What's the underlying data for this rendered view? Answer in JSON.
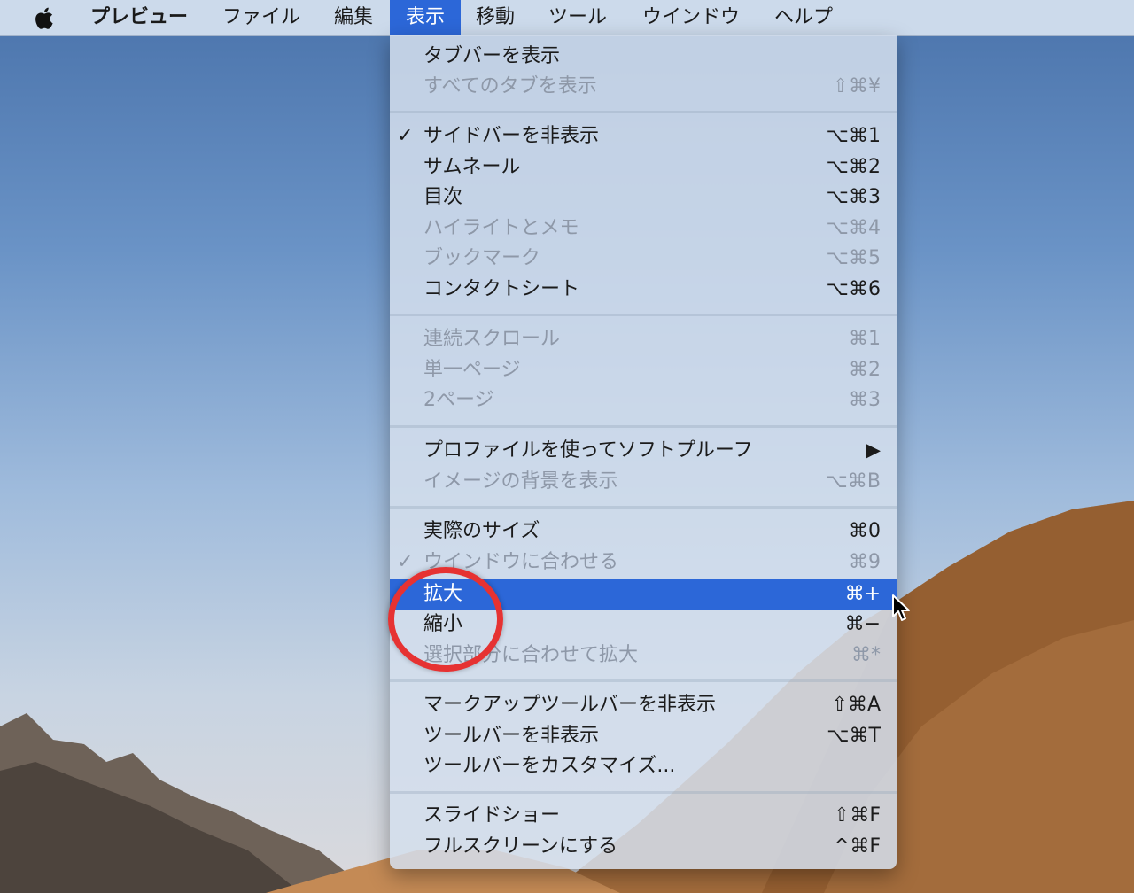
{
  "menubar": {
    "items": [
      {
        "label": "プレビュー",
        "bold": true,
        "active": false
      },
      {
        "label": "ファイル",
        "bold": false,
        "active": false
      },
      {
        "label": "編集",
        "bold": false,
        "active": false
      },
      {
        "label": "表示",
        "bold": false,
        "active": true
      },
      {
        "label": "移動",
        "bold": false,
        "active": false
      },
      {
        "label": "ツール",
        "bold": false,
        "active": false
      },
      {
        "label": "ウインドウ",
        "bold": false,
        "active": false
      },
      {
        "label": "ヘルプ",
        "bold": false,
        "active": false
      }
    ]
  },
  "view_menu": {
    "groups": [
      [
        {
          "label": "タブバーを表示",
          "shortcut": "",
          "enabled": true
        },
        {
          "label": "すべてのタブを表示",
          "shortcut": "⇧⌘¥",
          "enabled": false
        }
      ],
      [
        {
          "label": "サイドバーを非表示",
          "shortcut": "⌥⌘1",
          "enabled": true,
          "checked": true
        },
        {
          "label": "サムネール",
          "shortcut": "⌥⌘2",
          "enabled": true
        },
        {
          "label": "目次",
          "shortcut": "⌥⌘3",
          "enabled": true
        },
        {
          "label": "ハイライトとメモ",
          "shortcut": "⌥⌘4",
          "enabled": false
        },
        {
          "label": "ブックマーク",
          "shortcut": "⌥⌘5",
          "enabled": false
        },
        {
          "label": "コンタクトシート",
          "shortcut": "⌥⌘6",
          "enabled": true
        }
      ],
      [
        {
          "label": "連続スクロール",
          "shortcut": "⌘1",
          "enabled": false
        },
        {
          "label": "単一ページ",
          "shortcut": "⌘2",
          "enabled": false
        },
        {
          "label": "2ページ",
          "shortcut": "⌘3",
          "enabled": false
        }
      ],
      [
        {
          "label": "プロファイルを使ってソフトプルーフ",
          "shortcut": "▶",
          "enabled": true,
          "submenu": true
        },
        {
          "label": "イメージの背景を表示",
          "shortcut": "⌥⌘B",
          "enabled": false
        }
      ],
      [
        {
          "label": "実際のサイズ",
          "shortcut": "⌘0",
          "enabled": true
        },
        {
          "label": "ウインドウに合わせる",
          "shortcut": "⌘9",
          "enabled": false,
          "checked": true
        },
        {
          "label": "拡大",
          "shortcut": "⌘+",
          "enabled": true,
          "highlighted": true
        },
        {
          "label": "縮小",
          "shortcut": "⌘−",
          "enabled": true
        },
        {
          "label": "選択部分に合わせて拡大",
          "shortcut": "⌘*",
          "enabled": false
        }
      ],
      [
        {
          "label": "マークアップツールバーを非表示",
          "shortcut": "⇧⌘A",
          "enabled": true
        },
        {
          "label": "ツールバーを非表示",
          "shortcut": "⌥⌘T",
          "enabled": true
        },
        {
          "label": "ツールバーをカスタマイズ...",
          "shortcut": "",
          "enabled": true
        }
      ],
      [
        {
          "label": "スライドショー",
          "shortcut": "⇧⌘F",
          "enabled": true
        },
        {
          "label": "フルスクリーンにする",
          "shortcut": "^⌘F",
          "enabled": true
        }
      ]
    ],
    "check_mark": "✓"
  },
  "colors": {
    "highlight": "#2c67d8",
    "annotation": "#e63232",
    "disabled_text": "#8e98a8"
  }
}
